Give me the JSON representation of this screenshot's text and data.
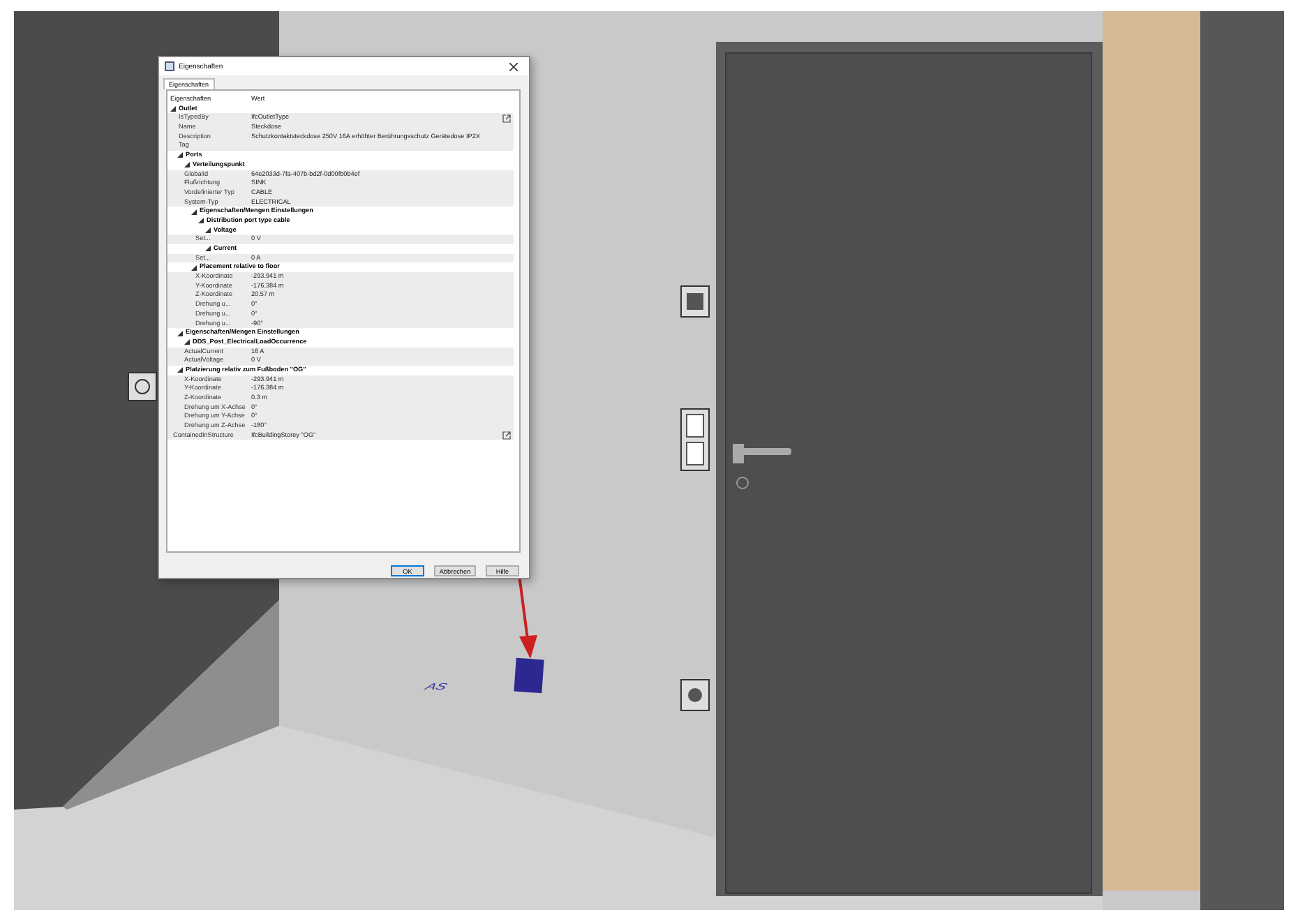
{
  "viewport": {
    "floor_label": "AS"
  },
  "dialog": {
    "title": "Eigenschaften",
    "tab": "Eigenschaften",
    "columns": [
      "Eigenschaften",
      "Wert"
    ],
    "rows": [
      {
        "kind": "group",
        "label": "Outlet",
        "expanded": true,
        "children": [
          {
            "kind": "link",
            "name": "IsTypedBy",
            "value": "IfcOutletType"
          },
          {
            "kind": "prop",
            "name": "Name",
            "value": "Steckdose"
          },
          {
            "kind": "prop",
            "name": "Description",
            "value": "Schutzkontaktsteckdose 250V 16A erhöhter Berührungsschutz Gerätedose IP2X"
          },
          {
            "kind": "prop",
            "name": "Tag"
          },
          {
            "kind": "group",
            "label": "Ports",
            "expanded": true,
            "children": [
              {
                "kind": "group",
                "label": "Verteilungspunkt",
                "expanded": true,
                "children": [
                  {
                    "kind": "prop",
                    "name": "GlobalId",
                    "value": "64e2033d-7fa-407b-bd2f-0d00fb0b4ef"
                  },
                  {
                    "kind": "prop",
                    "name": "Flußrichtung",
                    "value": "SINK"
                  },
                  {
                    "kind": "prop",
                    "name": "Vordefinierter Typ",
                    "value": "CABLE"
                  },
                  {
                    "kind": "prop",
                    "name": "System-Typ",
                    "value": "ELECTRICAL"
                  },
                  {
                    "kind": "group",
                    "label": "Eigenschaften/Mengen Einstellungen",
                    "expanded": true,
                    "children": [
                      {
                        "kind": "group",
                        "label": "Distribution port type cable",
                        "expanded": true,
                        "children": [
                          {
                            "kind": "group",
                            "label": "Voltage",
                            "expanded": true,
                            "children": [
                              {
                                "kind": "prop",
                                "name": "Set...",
                                "value": "0 V"
                              }
                            ]
                          },
                          {
                            "kind": "group",
                            "label": "Current",
                            "expanded": true,
                            "children": [
                              {
                                "kind": "prop",
                                "name": "Set...",
                                "value": "0 A"
                              }
                            ]
                          }
                        ]
                      }
                    ]
                  },
                  {
                    "kind": "group",
                    "label": "Placement relative to floor",
                    "expanded": true,
                    "children": [
                      {
                        "kind": "prop",
                        "name": "X-Koordinate",
                        "value": "-293.941 m"
                      },
                      {
                        "kind": "prop",
                        "name": "Y-Koordinate",
                        "value": "-176.384 m"
                      },
                      {
                        "kind": "prop",
                        "name": "Z-Koordinate",
                        "value": "20.57 m"
                      },
                      {
                        "kind": "prop",
                        "name": "Drehung u...",
                        "value": "0°"
                      },
                      {
                        "kind": "prop",
                        "name": "Drehung u...",
                        "value": "0°"
                      },
                      {
                        "kind": "prop",
                        "name": "Drehung u...",
                        "value": "-90°"
                      }
                    ]
                  }
                ]
              }
            ]
          },
          {
            "kind": "group",
            "label": "Eigenschaften/Mengen Einstellungen",
            "expanded": true,
            "children": [
              {
                "kind": "group",
                "label": "DDS_Post_ElectricalLoadOccurrence",
                "expanded": true,
                "children": [
                  {
                    "kind": "prop",
                    "name": "ActualCurrent",
                    "value": "16 A"
                  },
                  {
                    "kind": "prop",
                    "name": "ActualVoltage",
                    "value": "0 V"
                  }
                ]
              }
            ]
          },
          {
            "kind": "group",
            "label": "Platzierung relativ zum Fußboden \"OG\"",
            "expanded": true,
            "children": [
              {
                "kind": "prop",
                "name": "X-Koordinate",
                "value": "-293.941 m"
              },
              {
                "kind": "prop",
                "name": "Y-Koordinate",
                "value": "-176.384 m"
              },
              {
                "kind": "prop",
                "name": "Z-Koordinate",
                "value": "0.3 m"
              },
              {
                "kind": "prop",
                "name": "Drehung um X-Achse",
                "value": "0°"
              },
              {
                "kind": "prop",
                "name": "Drehung um Y-Achse",
                "value": "0°"
              },
              {
                "kind": "prop",
                "name": "Drehung um Z-Achse",
                "value": "-180°"
              }
            ]
          }
        ]
      },
      {
        "kind": "link",
        "name": "ContainedInStructure",
        "value": "IfcBuildingStorey \"OG\""
      }
    ],
    "buttons": [
      {
        "label": "OK",
        "default": true
      },
      {
        "label": "Abbrechen",
        "default": false
      },
      {
        "label": "Hilfe",
        "default": false
      }
    ]
  }
}
